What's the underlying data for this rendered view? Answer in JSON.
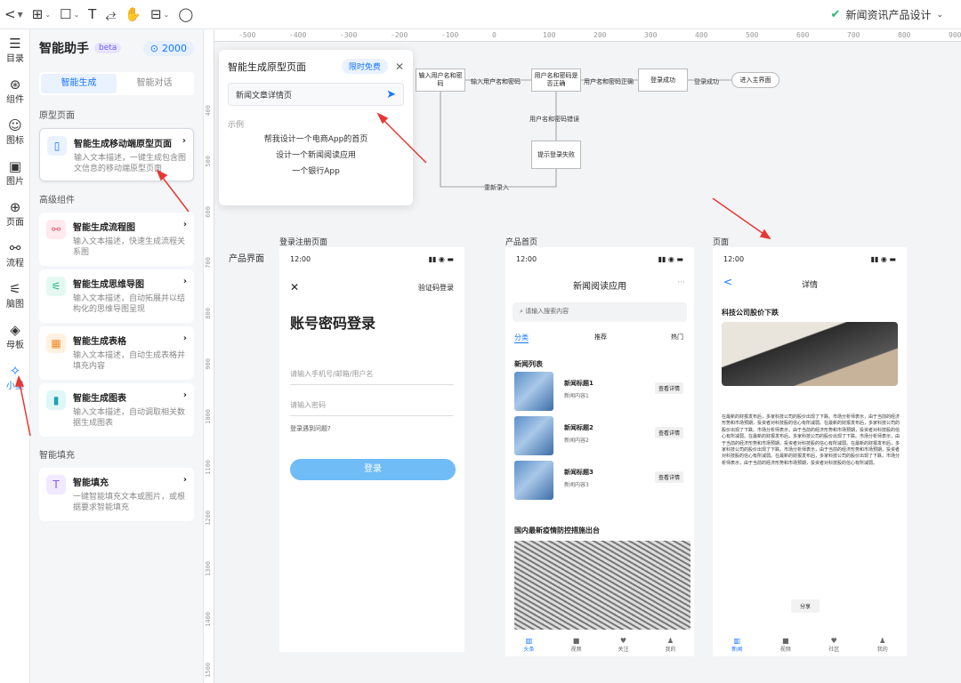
{
  "toolbar": {
    "back": "<",
    "project_name": "新闻资讯产品设计"
  },
  "rail": [
    {
      "label": "目录",
      "icon": "☰"
    },
    {
      "label": "组件",
      "icon": "⊛"
    },
    {
      "label": "图标",
      "icon": "☺"
    },
    {
      "label": "图片",
      "icon": "▣"
    },
    {
      "label": "页面",
      "icon": "⊕"
    },
    {
      "label": "流程",
      "icon": "⚯"
    },
    {
      "label": "脑图",
      "icon": "⚟"
    },
    {
      "label": "母板",
      "icon": "◈"
    },
    {
      "label": "小墨",
      "icon": "✧"
    }
  ],
  "assistant": {
    "title": "智能助手",
    "beta": "beta",
    "credits": "2000",
    "tabs": [
      "智能生成",
      "智能对话"
    ],
    "sections": {
      "prototype": "原型页面",
      "advanced": "高级组件",
      "fill": "智能填充"
    },
    "cards": [
      {
        "title": "智能生成移动端原型页面",
        "desc": "输入文本描述，一键生成包含图文信息的移动端原型页面"
      },
      {
        "title": "智能生成流程图",
        "desc": "输入文本描述，快速生成流程关系图"
      },
      {
        "title": "智能生成思维导图",
        "desc": "输入文本描述，自动拓展并以结构化的思维导图呈现"
      },
      {
        "title": "智能生成表格",
        "desc": "输入文本描述，自动生成表格并填充内容"
      },
      {
        "title": "智能生成图表",
        "desc": "输入文本描述，自动调取相关数据生成图表"
      },
      {
        "title": "智能填充",
        "desc": "一键智能填充文本或图片，或根据要求智能填充"
      }
    ]
  },
  "ruler_top": [
    "-500",
    "-400",
    "-300",
    "-200",
    "-100",
    "0",
    "100",
    "200",
    "300",
    "400",
    "500",
    "600",
    "700",
    "800",
    "900"
  ],
  "ruler_left": [
    "400",
    "500",
    "600",
    "700",
    "800",
    "900",
    "1000",
    "1100",
    "1200",
    "1300",
    "1400",
    "1500"
  ],
  "popup": {
    "title": "智能生成原型页面",
    "badge": "限时免费",
    "input": "新闻文章详情页",
    "examples_label": "示例",
    "examples": [
      "帮我设计一个电商App的首页",
      "设计一个新闻阅读应用",
      "一个银行App"
    ]
  },
  "flow": {
    "n1": "输入用户名和密码",
    "n2": "用户名和密码是否正确",
    "n3": "登录成功",
    "n4": "进入主界面",
    "n5": "提示登录失败",
    "e1": "输入用户名和密码",
    "e2": "用户名和密码正确",
    "e3": "登录成功",
    "e4": "用户名和密码错误",
    "e5": "重新录入"
  },
  "screens": {
    "section_label": "产品界面",
    "login": {
      "label": "登录注册页面",
      "time": "12:00",
      "close": "✕",
      "sms": "验证码登录",
      "heading": "账号密码登录",
      "user_ph": "请输入手机号/邮箱/用户名",
      "pwd_ph": "请输入密码",
      "problem": "登录遇到问题?",
      "btn": "登录"
    },
    "home": {
      "label": "产品首页",
      "time": "12:00",
      "title": "新闻阅读应用",
      "more": "···",
      "search_ph": "请输入搜索内容",
      "tabs": [
        "分类",
        "推荐",
        "热门"
      ],
      "list_title": "新闻列表",
      "items": [
        {
          "title": "新闻标题1",
          "sub": "新闻内容1",
          "btn": "查看详情"
        },
        {
          "title": "新闻标题2",
          "sub": "新闻内容2",
          "btn": "查看详情"
        },
        {
          "title": "新闻标题3",
          "sub": "新闻内容3",
          "btn": "查看详情"
        }
      ],
      "headline": "国内最新疫情防控措施出台",
      "tabbar": [
        "头条",
        "视频",
        "关注",
        "我的"
      ]
    },
    "detail": {
      "label": "页面",
      "time": "12:00",
      "back": "<",
      "title": "详情",
      "heading": "科技公司股价下跌",
      "body": "在最新的财报发布后，多家科技公司的股价出现了下跌。市场分析师表示，由于当前的经济形势和市场预期，投资者对科技股的信心有所减弱。在最新的财报发布后，多家科技公司的股价出现了下跌。市场分析师表示，由于当前的经济形势和市场预期，投资者对科技股的信心有所减弱。在最新的财报发布后，多家科技公司的股价出现了下跌。市场分析师表示，由于当前的经济形势和市场预期，投资者对科技股的信心有所减弱。在最新的财报发布后，多家科技公司的股价出现了下跌。市场分析师表示，由于当前的经济形势和市场预期，投资者对科技股的信心有所减弱。在最新的财报发布后，多家科技公司的股价出现了下跌。市场分析师表示，由于当前的经济形势和市场预期，投资者对科技股的信心有所减弱。",
      "share": "分享",
      "tabbar": [
        "新闻",
        "视频",
        "社区",
        "我的"
      ]
    }
  },
  "colors": {
    "accent": "#1677ff",
    "arrow": "#e53935",
    "ok": "#22b573"
  }
}
